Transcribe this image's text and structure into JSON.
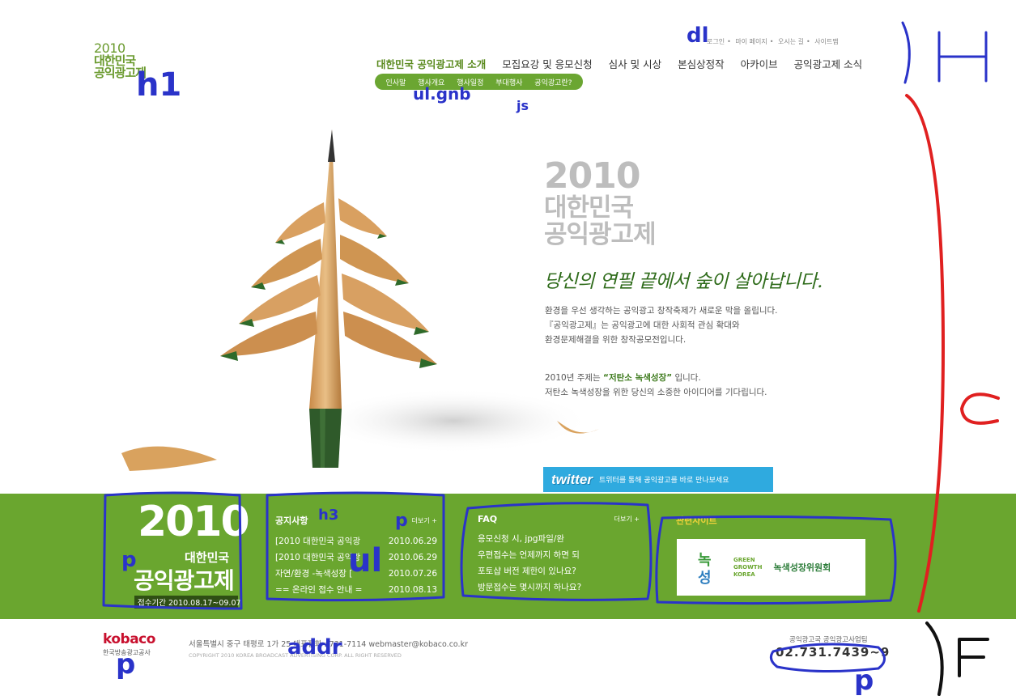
{
  "header": {
    "logo": {
      "year": "2010",
      "line1": "대한민국",
      "line2": "공익광고제"
    },
    "util_links": [
      "로그인",
      "마이 페이지",
      "오시는 길",
      "사이트맵"
    ],
    "gnb": [
      "대한민국 공익광고제 소개",
      "모집요강 및 응모신청",
      "심사 및 시상",
      "본심상정작",
      "아카이브",
      "공익광고제 소식"
    ],
    "lnb": [
      "인사말",
      "행사개요",
      "행사일정",
      "부대행사",
      "공익광고란?"
    ]
  },
  "visual": {
    "year": "2010",
    "title1": "대한민국",
    "title2": "공익광고제",
    "slogan": "당신의 연필 끝에서 숲이 살아납니다.",
    "intro": [
      "환경을 우선 생각하는 공익광고 창작축제가 새로운 막을 올립니다.",
      "『공익광고제』는 공익광고에 대한 사회적 관심 확대와",
      "환경문제해결을 위한 창작공모전입니다."
    ],
    "theme_pre": "2010년 주제는 ",
    "theme_bold": "“저탄소 녹색성장”",
    "theme_post": " 입니다.",
    "theme_line2": "저탄소 녹색성장을 위한 당신의 소중한 아이디어를 기다립니다.",
    "twitter_logo": "twitter",
    "twitter_text": "트위터를 통해 공익광고를 바로 만나보세요"
  },
  "band": {
    "year": "2010",
    "title1": "대한민국",
    "title2": "공익광고제",
    "period": "접수기간  2010.08.17~09.07",
    "notice": {
      "title": "공지사항",
      "more": "더보기 +",
      "items": [
        {
          "text": "[2010 대한민국 공익광",
          "date": "2010.06.29"
        },
        {
          "text": "[2010 대한민국 공익광",
          "date": "2010.06.29"
        },
        {
          "text": "자연/환경 -녹색성장 [",
          "date": "2010.07.26"
        },
        {
          "text": "== 온라인 접수 안내 =",
          "date": "2010.08.13"
        }
      ]
    },
    "faq": {
      "title": "FAQ",
      "more": "더보기 +",
      "items": [
        "응모신청 시, jpg파일/완",
        "우편접수는 언제까지 하면 되",
        "포토샵 버전 제한이 있나요?",
        "방문접수는 몇시까지 하나요?"
      ]
    },
    "sites": {
      "title": "관련사이트",
      "logo_en1": "GREEN",
      "logo_en2": "GROWTH",
      "logo_en3": "KOREA",
      "logo_kr": "녹색성장위원회"
    }
  },
  "footer": {
    "logo": "kobaco",
    "logo_sub": "한국방송광고공사",
    "address": "서울특별시 중구 태평로 1가 25 대표전화 : 731-7114  webmaster@kobaco.co.kr",
    "copyright": "COPYRIGHT 2010 KOREA BROADCAST ADVERTISING CORP. ALL RIGHT RESERVED",
    "tel_label": "공익광고국 공익광고사업팀",
    "tel": "02.731.7439~9"
  },
  "annotations": {
    "h1": "h1",
    "dl": "dl",
    "ul_gnb": "ul.gnb",
    "js": "js",
    "H": "H",
    "C": "C",
    "F": "F",
    "p_band": "p",
    "h3": "h3",
    "ul": "ul",
    "p_more": "p",
    "p_foot": "p",
    "addr": "addr",
    "p_tel": "p"
  },
  "colors": {
    "green": "#6aa62f",
    "twitter": "#2faadf",
    "annotation_blue": "#2a33c9",
    "annotation_red": "#e02020"
  }
}
